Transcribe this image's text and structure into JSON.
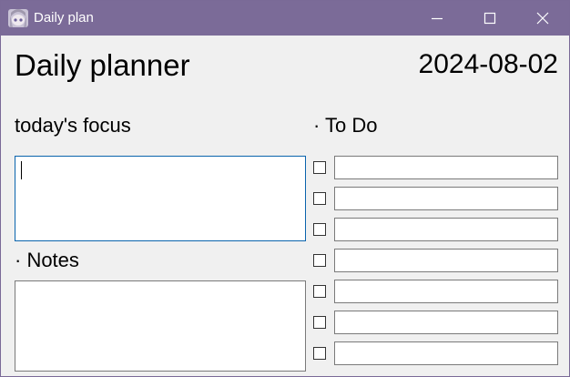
{
  "window": {
    "title": "Daily plan",
    "titlebar_color": "#7b6b98",
    "focus_border_color": "#0a64ad"
  },
  "header": {
    "title": "Daily planner",
    "date": "2024-08-02"
  },
  "focus": {
    "label": "today's focus",
    "value": ""
  },
  "todo": {
    "label": "· To Do",
    "items": [
      {
        "checked": false,
        "text": ""
      },
      {
        "checked": false,
        "text": ""
      },
      {
        "checked": false,
        "text": ""
      },
      {
        "checked": false,
        "text": ""
      },
      {
        "checked": false,
        "text": ""
      },
      {
        "checked": false,
        "text": ""
      },
      {
        "checked": false,
        "text": ""
      }
    ]
  },
  "notes": {
    "label": "· Notes",
    "value": ""
  },
  "icons": {
    "app": "app-avatar-icon",
    "minimize": "minimize-icon",
    "maximize": "maximize-icon",
    "close": "close-icon"
  }
}
